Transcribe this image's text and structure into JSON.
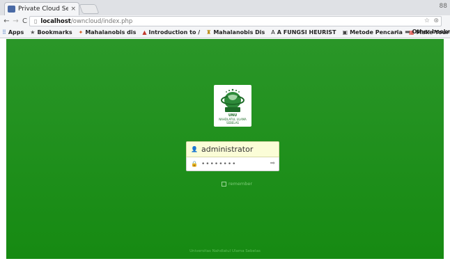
{
  "browser": {
    "tab_title": "Private Cloud Serv",
    "tab_close": "×",
    "window_controls": "88",
    "url_host": "localhost",
    "url_path": "/owncloud/index.php",
    "bookmarks": [
      {
        "label": "Apps",
        "icon": "apps-grid-icon"
      },
      {
        "label": "Bookmarks",
        "icon": "star-icon"
      },
      {
        "label": "Mahalanobis dis",
        "icon": "bookmark-favicon"
      },
      {
        "label": "Introduction to /",
        "icon": "bookmark-favicon"
      },
      {
        "label": "Mahalanobis Dis",
        "icon": "bookmark-favicon"
      },
      {
        "label": "A FUNGSI HEURIST",
        "icon": "bookmark-favicon"
      },
      {
        "label": "Metode Pencaria",
        "icon": "bookmark-favicon"
      },
      {
        "label": "Make Your Own",
        "icon": "bookmark-favicon"
      }
    ],
    "bookmarks_overflow": "»",
    "other_bookmarks": "Other bookmar"
  },
  "logo": {
    "text_lines": [
      "UNU",
      "NAHDLATUL ULAMA",
      "SEBELAS"
    ]
  },
  "login": {
    "username_value": "administrator",
    "password_value": "••••••••",
    "remember_label": "remember"
  },
  "footer": {
    "text": "Universitas Nahdlatul Ulama Sebelas"
  },
  "colors": {
    "page_background": "#1f8f1c",
    "username_field_background": "#fbfdd7",
    "footer_text": "#5fbc5a"
  }
}
